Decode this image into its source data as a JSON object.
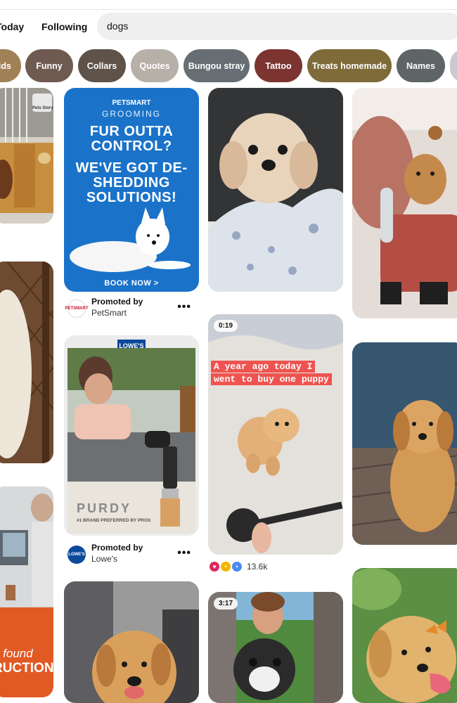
{
  "header": {
    "tabs": [
      "Today",
      "Following"
    ],
    "search_value": "dogs"
  },
  "chips": [
    {
      "label": "Kids",
      "color": "#a08055"
    },
    {
      "label": "Funny",
      "color": "#6f5a52"
    },
    {
      "label": "Collars",
      "color": "#5e5249"
    },
    {
      "label": "Quotes",
      "color": "#b7b0a8"
    },
    {
      "label": "Bungou stray",
      "color": "#666e73"
    },
    {
      "label": "Tattoo",
      "color": "#7c3431"
    },
    {
      "label": "Treats homemade",
      "color": "#7f6a3a"
    },
    {
      "label": "Names",
      "color": "#5f6466"
    },
    {
      "label": "",
      "color": "#c9c9cf"
    }
  ],
  "pins": {
    "petsmart_ad": {
      "brand": "PETSMART",
      "service": "GROOMING",
      "headline1": "FUR OUTTA CONTROL?",
      "headline2": "WE'VE GOT DE-SHEDDING SOLUTIONS!",
      "cta": "BOOK NOW >",
      "promoted_label": "Promoted by",
      "advertiser": "PetSmart"
    },
    "lowes_ad": {
      "brand": "LOWE'S",
      "product_brand": "PURDY",
      "product_tagline": "#1 BRAND PREFERRED BY PROS",
      "promoted_label": "Promoted by",
      "advertiser": "Lowe's"
    },
    "puppy_video": {
      "duration": "0:19",
      "caption": "A year ago today I went to buy one puppy",
      "reaction_count": "13.6k"
    },
    "pug_video": {
      "duration": "3:17"
    },
    "left_orange": {
      "line1": "n found",
      "line2": "RUCTION"
    },
    "pets_story": {
      "label": "Pets Story"
    }
  },
  "colors": {
    "accent_red": "#e60023",
    "petsmart_blue": "#1a73c9",
    "caption_red": "#ef5350",
    "lowes_blue": "#0b4a9b"
  }
}
